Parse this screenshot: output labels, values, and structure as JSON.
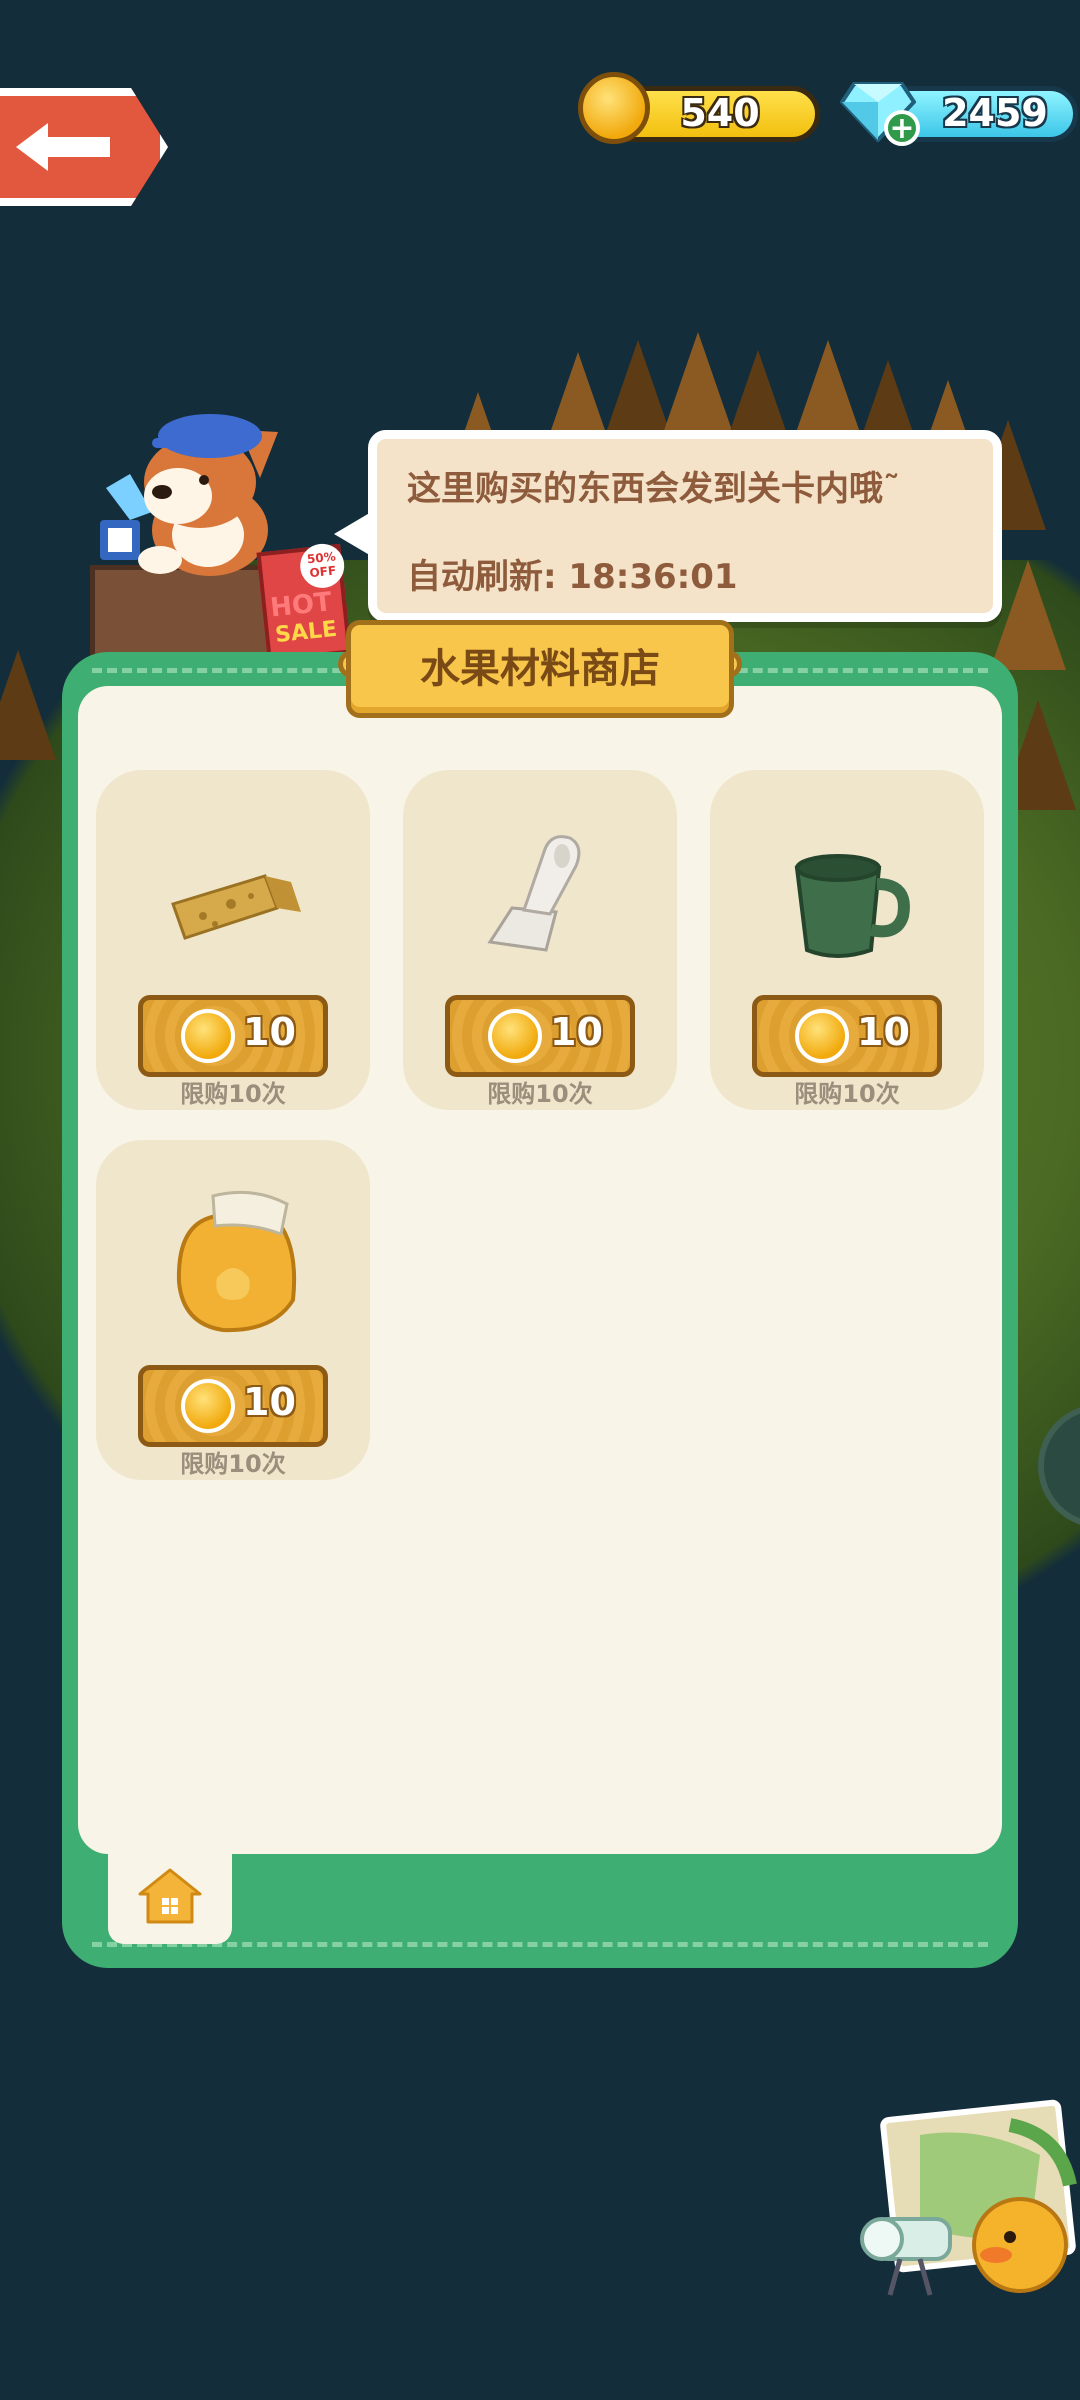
{
  "currency": {
    "coins": "540",
    "gems": "2459",
    "gems_add_label": "+"
  },
  "shopkeeper": {
    "badge_top": "50%",
    "badge_bottom": "OFF",
    "sign_hot": "HOT",
    "sign_sale": "SALE"
  },
  "speech": {
    "line1": "这里购买的东西会发到关卡内哦˜",
    "line2": "自动刷新: 18:36:01"
  },
  "shop": {
    "title": "水果材料商店",
    "items": [
      {
        "icon": "sponge-block-icon",
        "price": "10",
        "limit": "限购10次"
      },
      {
        "icon": "scraper-tool-icon",
        "price": "10",
        "limit": "限购10次"
      },
      {
        "icon": "green-mug-icon",
        "price": "10",
        "limit": "限购10次"
      },
      {
        "icon": "flour-bag-icon",
        "price": "10",
        "limit": "限购10次"
      }
    ]
  },
  "colors": {
    "background": "#132d3b",
    "panel_green": "#3fae73",
    "panel_inner": "#f8f4e7",
    "card": "#f0e6cc",
    "price_button": "#e4a531",
    "title_banner": "#f7c64a",
    "back_button": "#e2583e"
  }
}
